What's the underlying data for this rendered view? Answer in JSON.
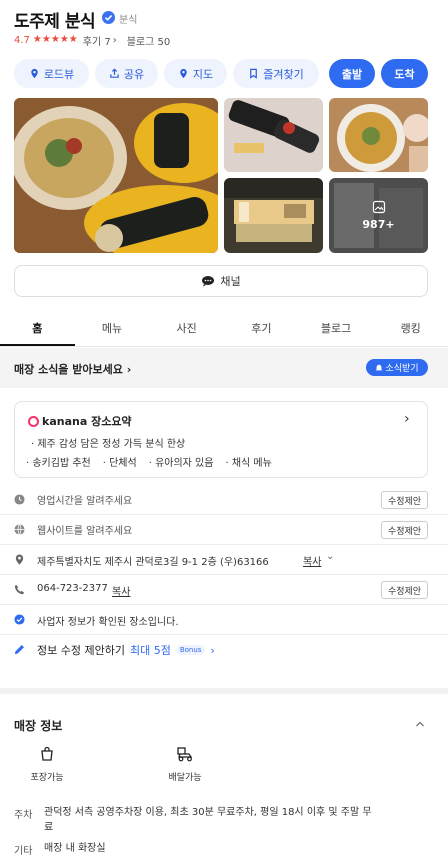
{
  "header": {
    "title": "도주제 분식",
    "category": "분식",
    "rating": "4.7",
    "reviews": "후기 7",
    "blog": "블로그 50"
  },
  "actions": {
    "roadview": "로드뷰",
    "share": "공유",
    "map": "지도",
    "favorite": "즐겨찾기",
    "depart": "출발",
    "arrive": "도착"
  },
  "photos": {
    "more_count": "987+"
  },
  "channel_label": "채널",
  "tabs": [
    "홈",
    "메뉴",
    "사진",
    "후기",
    "블로그",
    "랭킹"
  ],
  "news": {
    "text": "매장 소식을 받아보세요",
    "button": "소식받기"
  },
  "summary": {
    "title": "kanana 장소요약",
    "line1": "· 제주 감성 담은 정성 가득 분식 한상",
    "tags": [
      "· 송키김밥 추천",
      "· 단체석",
      "· 유아의자 있음",
      "· 채식 메뉴"
    ]
  },
  "info": {
    "hours": "영업시간을 알려주세요",
    "website": "웹사이트를 알려주세요",
    "address": "제주특별자치도 제주시 관덕로3길 9-1 2층 (우)63166",
    "address_copy": "복사",
    "phone": "064-723-2377",
    "phone_copy": "복사",
    "verified": "사업자 정보가 확인된 장소입니다.",
    "edit_label": "수정제안",
    "suggest": "정보 수정 제안하기",
    "suggest_points": "최대 5점",
    "bonus": "Bonus"
  },
  "store_info": {
    "title": "매장 정보",
    "amenity_takeout": "포장가능",
    "amenity_delivery": "배달가능",
    "parking_label": "주차",
    "parking_text_1": "관덕정 서측 공영주차장 이용, 최초 30분 무료주차, 평일 18시 이후 및 주말 무",
    "parking_text_2": "료",
    "etc_label": "기타",
    "etc_text": "매장 내 화장실"
  },
  "colors": {
    "accent": "#2f6bf1",
    "rating": "#e94c3c"
  }
}
